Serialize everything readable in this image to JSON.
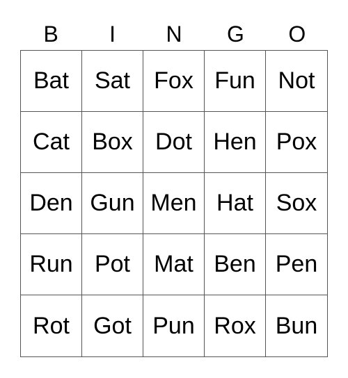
{
  "header": [
    "B",
    "I",
    "N",
    "G",
    "O"
  ],
  "rows": [
    [
      "Bat",
      "Sat",
      "Fox",
      "Fun",
      "Not"
    ],
    [
      "Cat",
      "Box",
      "Dot",
      "Hen",
      "Pox"
    ],
    [
      "Den",
      "Gun",
      "Men",
      "Hat",
      "Sox"
    ],
    [
      "Run",
      "Pot",
      "Mat",
      "Ben",
      "Pen"
    ],
    [
      "Rot",
      "Got",
      "Pun",
      "Rox",
      "Bun"
    ]
  ]
}
